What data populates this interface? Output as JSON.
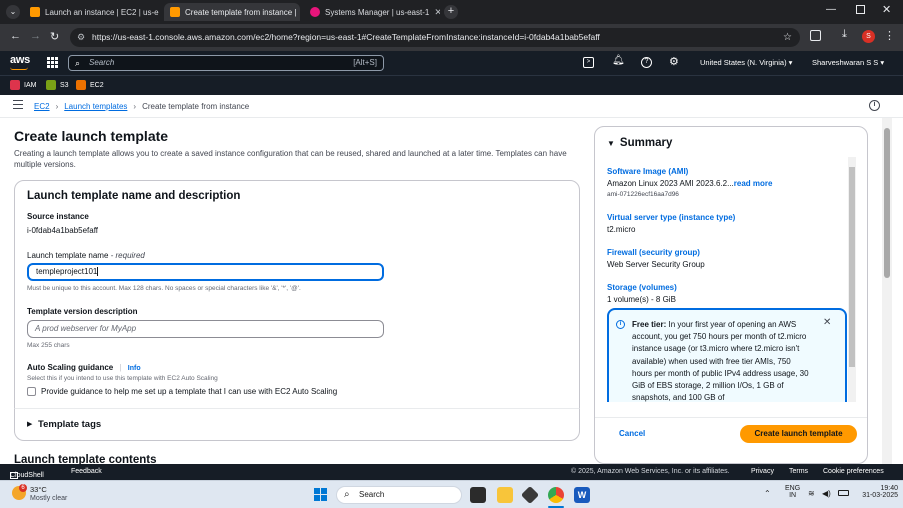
{
  "browser": {
    "tabs": [
      {
        "label": "Launch an instance | EC2 | us-e",
        "active": false,
        "favicon_color": "#ff9900"
      },
      {
        "label": "Create template from instance |",
        "active": true,
        "favicon_color": "#ff9900"
      },
      {
        "label": "Systems Manager | us-east-1",
        "active": false,
        "favicon_color": "#e7157b"
      }
    ],
    "url": "https://us-east-1.console.aws.amazon.com/ec2/home?region=us-east-1#CreateTemplateFromInstance:instanceId=i-0fdab4a1bab5efaff",
    "profile_initial": "S"
  },
  "aws_header": {
    "logo": "aws",
    "search_placeholder": "Search",
    "search_shortcut": "[Alt+S]",
    "region": "United States (N. Virginia)",
    "user": "Sharveshwaran S S",
    "favorites": [
      {
        "label": "IAM",
        "color": "#dd344c"
      },
      {
        "label": "S3",
        "color": "#7aa116"
      },
      {
        "label": "EC2",
        "color": "#ed7100"
      }
    ]
  },
  "breadcrumb": {
    "items": [
      "EC2",
      "Launch templates",
      "Create template from instance"
    ]
  },
  "page": {
    "title": "Create launch template",
    "description": "Creating a launch template allows you to create a saved instance configuration that can be reused, shared and launched at a later time. Templates can have multiple versions."
  },
  "form": {
    "section_title": "Launch template name and description",
    "source_label": "Source instance",
    "source_value": "i-0fdab4a1bab5efaff",
    "name_label": "Launch template name",
    "name_required": " - required",
    "name_value": "templeproject101",
    "name_hint": "Must be unique to this account. Max 128 chars. No spaces or special characters like '&', '*', '@'.",
    "version_label": "Template version description",
    "version_placeholder": "A prod webserver for MyApp",
    "version_hint": "Max 255 chars",
    "asg_label": "Auto Scaling guidance",
    "asg_info": "Info",
    "asg_hint": "Select this if you intend to use this template with EC2 Auto Scaling",
    "asg_checkbox_label": "Provide guidance to help me set up a template that I can use with EC2 Auto Scaling",
    "tags_label": "Template tags",
    "next_section": "Launch template contents"
  },
  "summary": {
    "title": "Summary",
    "ami_label": "Software Image (AMI)",
    "ami_value": "Amazon Linux 2023 AMI 2023.6.2...",
    "ami_more": "read more",
    "ami_id": "ami-071226ecf16aa7d96",
    "type_label": "Virtual server type (instance type)",
    "type_value": "t2.micro",
    "firewall_label": "Firewall (security group)",
    "firewall_value": "Web Server Security Group",
    "storage_label": "Storage (volumes)",
    "storage_value": "1 volume(s) - 8 GiB",
    "free_tier_title": "Free tier:",
    "free_tier_text": "In your first year of opening an AWS account, you get 750 hours per month of t2.micro instance usage (or t3.micro where t2.micro isn't available) when used with free tier AMIs, 750 hours per month of public IPv4 address usage, 30 GiB of EBS storage, 2 million I/Os, 1 GB of snapshots, and 100 GB of",
    "cancel": "Cancel",
    "create": "Create launch template"
  },
  "footer": {
    "cloudshell": "CloudShell",
    "feedback": "Feedback",
    "copyright": "© 2025, Amazon Web Services, Inc. or its affiliates.",
    "privacy": "Privacy",
    "terms": "Terms",
    "cookies": "Cookie preferences"
  },
  "taskbar": {
    "weather_temp": "33°C",
    "weather_desc": "Mostly clear",
    "weather_badge": "6",
    "search": "Search",
    "lang_top": "ENG",
    "lang_bottom": "IN",
    "time": "19:40",
    "date": "31-03-2025"
  }
}
